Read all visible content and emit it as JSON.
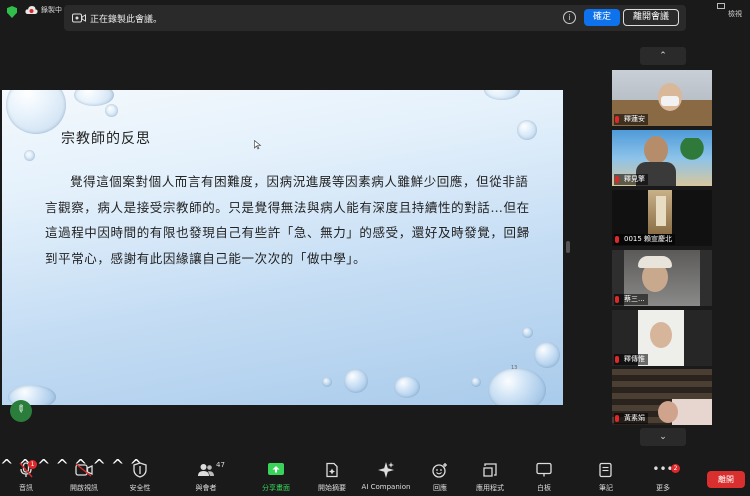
{
  "top_bar": {
    "recording_label": "錄製中",
    "notice_text": "正在錄製此會議。",
    "confirm_button": "確定",
    "leave_button": "離開會議",
    "fullscreen_label": "檢視"
  },
  "slide": {
    "title": "宗教師的反思",
    "paragraph": "覺得這個案對個人而言有困難度，因病況進展等因素病人雖鮮少回應，但從非語言觀察，病人是接受宗教師的。只是覺得無法與病人能有深度且持續性的對話…但在這過程中因時間的有限也發現自己有些許「急、無力」的感受，還好及時發覺，回歸到平常心，感謝有此因緣讓自己能一次次的「做中學」。",
    "page_number": "13"
  },
  "participants": [
    {
      "name": "釋蓮安",
      "muted": true
    },
    {
      "name": "釋見擎",
      "muted": true
    },
    {
      "name": "0015 賴宣慶北",
      "muted": true
    },
    {
      "name": "蔡三...",
      "muted": true
    },
    {
      "name": "釋傳惟",
      "muted": true
    },
    {
      "name": "黃素娟",
      "muted": true
    }
  ],
  "toolbar": {
    "audio": "音訊",
    "video": "開啟視訊",
    "security": "安全性",
    "participants": "與會者",
    "participants_count": "47",
    "share": "分享畫面",
    "summary": "開始摘要",
    "ai": "AI Companion",
    "reactions": "回應",
    "apps": "應用程式",
    "whiteboard": "白板",
    "notes": "筆記",
    "more": "更多",
    "more_badge": "2",
    "audio_badge": "1",
    "end": "離開"
  },
  "colors": {
    "accent_blue": "#0e72ed",
    "share_green": "#3ad35a",
    "end_red": "#d9302f",
    "muted_red": "#e02828"
  }
}
